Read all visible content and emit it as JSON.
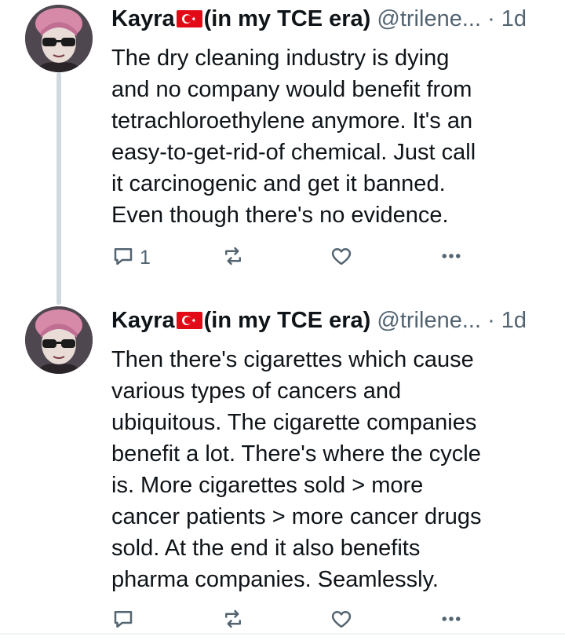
{
  "tweets": [
    {
      "display_name": "Kayra",
      "name_suffix": "(in my TCE era)",
      "handle": "@trilene...",
      "time": "· 1d",
      "body_lines": [
        "The dry cleaning industry is dying",
        "and no company would benefit from",
        "tetrachloroethylene anymore. It's an",
        "easy-to-get-rid-of chemical. Just call",
        "it carcinogenic and get it banned.",
        "Even though there's no evidence."
      ],
      "reply_count": "1"
    },
    {
      "display_name": "Kayra",
      "name_suffix": "(in my TCE era)",
      "handle": "@trilene...",
      "time": "· 1d",
      "body_lines": [
        "Then there's cigarettes which cause",
        "various types of cancers and",
        "ubiquitous. The cigarette companies",
        "benefit a lot. There's where the cycle",
        "is. More cigarettes sold > more",
        "cancer patients > more cancer drugs",
        "sold. At the end it also benefits",
        "pharma companies. Seamlessly."
      ],
      "reply_count": ""
    }
  ],
  "icons": {
    "reply": "reply-icon",
    "retweet": "retweet-icon",
    "like": "heart-icon",
    "more": "more-icon",
    "flag": "turkey-flag-icon"
  },
  "colors": {
    "text": "#0f1419",
    "secondary": "#536471",
    "thread_line": "#cfd9de",
    "flag_red": "#e30a17"
  }
}
